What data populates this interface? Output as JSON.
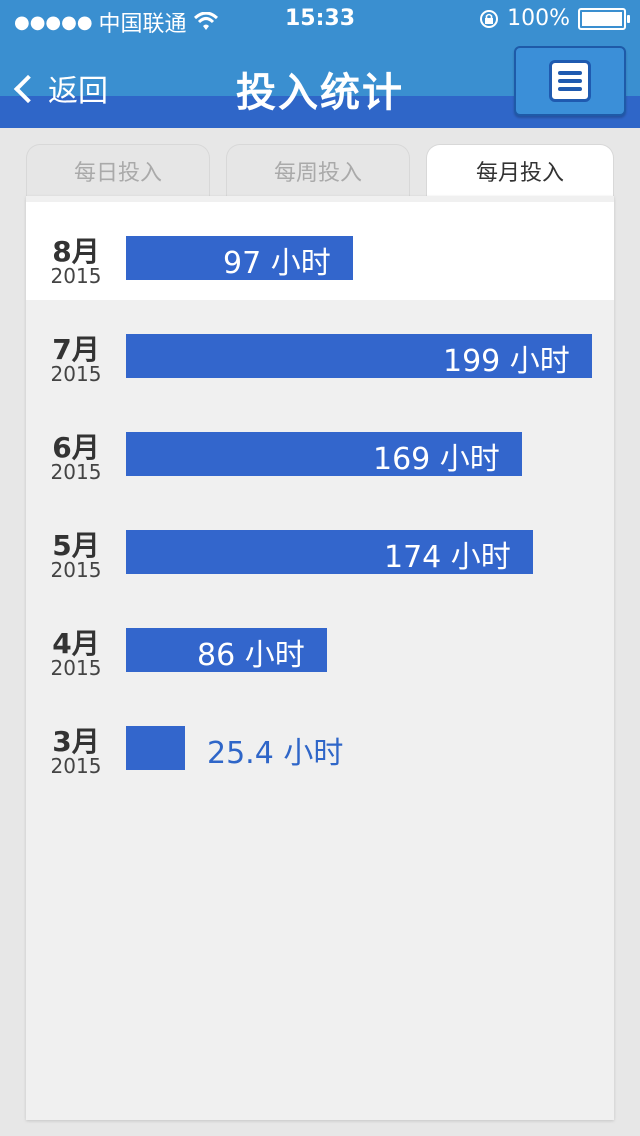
{
  "status_bar": {
    "signal": "●●●●●",
    "carrier": "中国联通",
    "time": "15:33",
    "battery": "100%"
  },
  "nav": {
    "back_label": "返回",
    "title": "投入统计"
  },
  "tabs": [
    {
      "label": "每日投入",
      "active": false
    },
    {
      "label": "每周投入",
      "active": false
    },
    {
      "label": "每月投入",
      "active": true
    }
  ],
  "colors": {
    "bar": "#3366cc",
    "header": "#3a8fd0",
    "header_dark": "#2f66c8"
  },
  "chart_data": {
    "type": "bar",
    "orientation": "horizontal",
    "unit": "小时",
    "max_value": 199,
    "categories": [
      {
        "month": "8月",
        "year": "2015"
      },
      {
        "month": "7月",
        "year": "2015"
      },
      {
        "month": "6月",
        "year": "2015"
      },
      {
        "month": "5月",
        "year": "2015"
      },
      {
        "month": "4月",
        "year": "2015"
      },
      {
        "month": "3月",
        "year": "2015"
      }
    ],
    "values": [
      97,
      199,
      169,
      174,
      86,
      25.4
    ],
    "value_labels": [
      "97 小时",
      "199 小时",
      "169 小时",
      "174 小时",
      "86 小时",
      "25.4 小时"
    ]
  }
}
